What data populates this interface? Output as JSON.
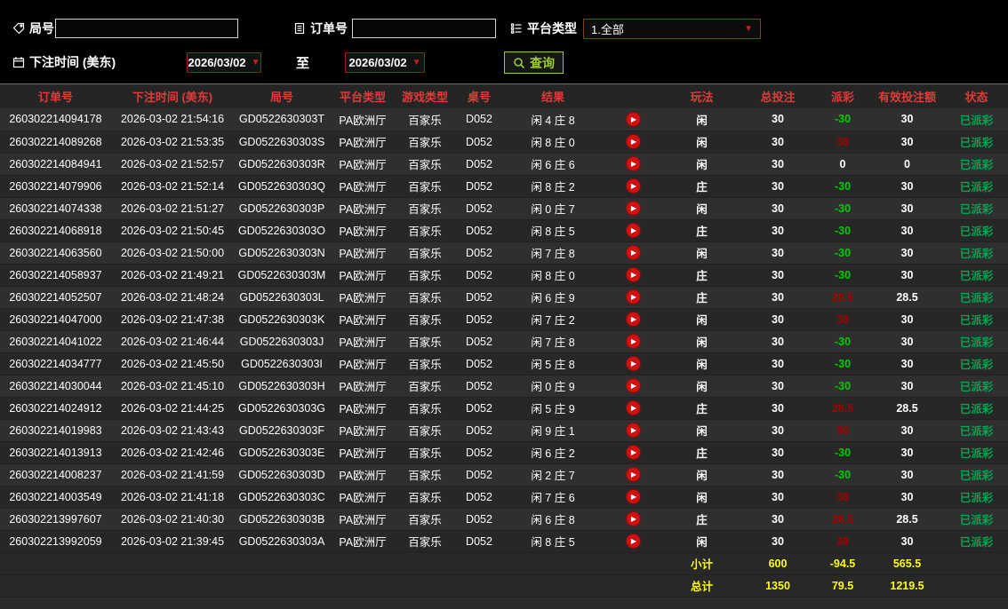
{
  "filters": {
    "round_label": "局号",
    "round_value": "",
    "order_label": "订单号",
    "order_value": "",
    "platform_label": "平台类型",
    "platform_value": "1.全部",
    "time_label": "下注时间 (美东)",
    "date_from": "2026/03/02",
    "to_label": "至",
    "date_to": "2026/03/02",
    "query_label": "查询"
  },
  "colors": {
    "header_red": "#e03b3b",
    "loss_green": "#00cc00",
    "win_red": "#a30000",
    "status_green": "#00a651",
    "summary_yellow": "#ffff00",
    "accent_green": "#9acd32"
  },
  "table": {
    "headers": [
      "订单号",
      "下注时间 (美东)",
      "局号",
      "平台类型",
      "游戏类型",
      "桌号",
      "结果",
      "",
      "玩法",
      "总投注",
      "派彩",
      "有效投注额",
      "状态"
    ],
    "rows": [
      {
        "order": "260302214094178",
        "time": "2026-03-02 21:54:16",
        "round": "GD0522630303T",
        "platform": "PA欧洲厅",
        "game": "百家乐",
        "table_no": "D052",
        "result": "闲 4 庄 8",
        "play": "闲",
        "total_bet": "30",
        "payout": "-30",
        "valid_bet": "30",
        "status": "已派彩"
      },
      {
        "order": "260302214089268",
        "time": "2026-03-02 21:53:35",
        "round": "GD0522630303S",
        "platform": "PA欧洲厅",
        "game": "百家乐",
        "table_no": "D052",
        "result": "闲 8 庄 0",
        "play": "闲",
        "total_bet": "30",
        "payout": "30",
        "valid_bet": "30",
        "status": "已派彩"
      },
      {
        "order": "260302214084941",
        "time": "2026-03-02 21:52:57",
        "round": "GD0522630303R",
        "platform": "PA欧洲厅",
        "game": "百家乐",
        "table_no": "D052",
        "result": "闲 6 庄 6",
        "play": "闲",
        "total_bet": "30",
        "payout": "0",
        "valid_bet": "0",
        "status": "已派彩"
      },
      {
        "order": "260302214079906",
        "time": "2026-03-02 21:52:14",
        "round": "GD0522630303Q",
        "platform": "PA欧洲厅",
        "game": "百家乐",
        "table_no": "D052",
        "result": "闲 8 庄 2",
        "play": "庄",
        "total_bet": "30",
        "payout": "-30",
        "valid_bet": "30",
        "status": "已派彩"
      },
      {
        "order": "260302214074338",
        "time": "2026-03-02 21:51:27",
        "round": "GD0522630303P",
        "platform": "PA欧洲厅",
        "game": "百家乐",
        "table_no": "D052",
        "result": "闲 0 庄 7",
        "play": "闲",
        "total_bet": "30",
        "payout": "-30",
        "valid_bet": "30",
        "status": "已派彩"
      },
      {
        "order": "260302214068918",
        "time": "2026-03-02 21:50:45",
        "round": "GD0522630303O",
        "platform": "PA欧洲厅",
        "game": "百家乐",
        "table_no": "D052",
        "result": "闲 8 庄 5",
        "play": "庄",
        "total_bet": "30",
        "payout": "-30",
        "valid_bet": "30",
        "status": "已派彩"
      },
      {
        "order": "260302214063560",
        "time": "2026-03-02 21:50:00",
        "round": "GD0522630303N",
        "platform": "PA欧洲厅",
        "game": "百家乐",
        "table_no": "D052",
        "result": "闲 7 庄 8",
        "play": "闲",
        "total_bet": "30",
        "payout": "-30",
        "valid_bet": "30",
        "status": "已派彩"
      },
      {
        "order": "260302214058937",
        "time": "2026-03-02 21:49:21",
        "round": "GD0522630303M",
        "platform": "PA欧洲厅",
        "game": "百家乐",
        "table_no": "D052",
        "result": "闲 8 庄 0",
        "play": "庄",
        "total_bet": "30",
        "payout": "-30",
        "valid_bet": "30",
        "status": "已派彩"
      },
      {
        "order": "260302214052507",
        "time": "2026-03-02 21:48:24",
        "round": "GD0522630303L",
        "platform": "PA欧洲厅",
        "game": "百家乐",
        "table_no": "D052",
        "result": "闲 6 庄 9",
        "play": "庄",
        "total_bet": "30",
        "payout": "28.5",
        "valid_bet": "28.5",
        "status": "已派彩"
      },
      {
        "order": "260302214047000",
        "time": "2026-03-02 21:47:38",
        "round": "GD0522630303K",
        "platform": "PA欧洲厅",
        "game": "百家乐",
        "table_no": "D052",
        "result": "闲 7 庄 2",
        "play": "闲",
        "total_bet": "30",
        "payout": "30",
        "valid_bet": "30",
        "status": "已派彩"
      },
      {
        "order": "260302214041022",
        "time": "2026-03-02 21:46:44",
        "round": "GD0522630303J",
        "platform": "PA欧洲厅",
        "game": "百家乐",
        "table_no": "D052",
        "result": "闲 7 庄 8",
        "play": "闲",
        "total_bet": "30",
        "payout": "-30",
        "valid_bet": "30",
        "status": "已派彩"
      },
      {
        "order": "260302214034777",
        "time": "2026-03-02 21:45:50",
        "round": "GD0522630303I",
        "platform": "PA欧洲厅",
        "game": "百家乐",
        "table_no": "D052",
        "result": "闲 5 庄 8",
        "play": "闲",
        "total_bet": "30",
        "payout": "-30",
        "valid_bet": "30",
        "status": "已派彩"
      },
      {
        "order": "260302214030044",
        "time": "2026-03-02 21:45:10",
        "round": "GD0522630303H",
        "platform": "PA欧洲厅",
        "game": "百家乐",
        "table_no": "D052",
        "result": "闲 0 庄 9",
        "play": "闲",
        "total_bet": "30",
        "payout": "-30",
        "valid_bet": "30",
        "status": "已派彩"
      },
      {
        "order": "260302214024912",
        "time": "2026-03-02 21:44:25",
        "round": "GD0522630303G",
        "platform": "PA欧洲厅",
        "game": "百家乐",
        "table_no": "D052",
        "result": "闲 5 庄 9",
        "play": "庄",
        "total_bet": "30",
        "payout": "28.5",
        "valid_bet": "28.5",
        "status": "已派彩"
      },
      {
        "order": "260302214019983",
        "time": "2026-03-02 21:43:43",
        "round": "GD0522630303F",
        "platform": "PA欧洲厅",
        "game": "百家乐",
        "table_no": "D052",
        "result": "闲 9 庄 1",
        "play": "闲",
        "total_bet": "30",
        "payout": "30",
        "valid_bet": "30",
        "status": "已派彩"
      },
      {
        "order": "260302214013913",
        "time": "2026-03-02 21:42:46",
        "round": "GD0522630303E",
        "platform": "PA欧洲厅",
        "game": "百家乐",
        "table_no": "D052",
        "result": "闲 6 庄 2",
        "play": "庄",
        "total_bet": "30",
        "payout": "-30",
        "valid_bet": "30",
        "status": "已派彩"
      },
      {
        "order": "260302214008237",
        "time": "2026-03-02 21:41:59",
        "round": "GD0522630303D",
        "platform": "PA欧洲厅",
        "game": "百家乐",
        "table_no": "D052",
        "result": "闲 2 庄 7",
        "play": "闲",
        "total_bet": "30",
        "payout": "-30",
        "valid_bet": "30",
        "status": "已派彩"
      },
      {
        "order": "260302214003549",
        "time": "2026-03-02 21:41:18",
        "round": "GD0522630303C",
        "platform": "PA欧洲厅",
        "game": "百家乐",
        "table_no": "D052",
        "result": "闲 7 庄 6",
        "play": "闲",
        "total_bet": "30",
        "payout": "30",
        "valid_bet": "30",
        "status": "已派彩"
      },
      {
        "order": "260302213997607",
        "time": "2026-03-02 21:40:30",
        "round": "GD0522630303B",
        "platform": "PA欧洲厅",
        "game": "百家乐",
        "table_no": "D052",
        "result": "闲 6 庄 8",
        "play": "庄",
        "total_bet": "30",
        "payout": "28.5",
        "valid_bet": "28.5",
        "status": "已派彩"
      },
      {
        "order": "260302213992059",
        "time": "2026-03-02 21:39:45",
        "round": "GD0522630303A",
        "platform": "PA欧洲厅",
        "game": "百家乐",
        "table_no": "D052",
        "result": "闲 8 庄 5",
        "play": "闲",
        "total_bet": "30",
        "payout": "30",
        "valid_bet": "30",
        "status": "已派彩"
      }
    ],
    "subtotal": {
      "label": "小计",
      "total_bet": "600",
      "payout": "-94.5",
      "valid_bet": "565.5"
    },
    "grand_total": {
      "label": "总计",
      "total_bet": "1350",
      "payout": "79.5",
      "valid_bet": "1219.5"
    }
  }
}
